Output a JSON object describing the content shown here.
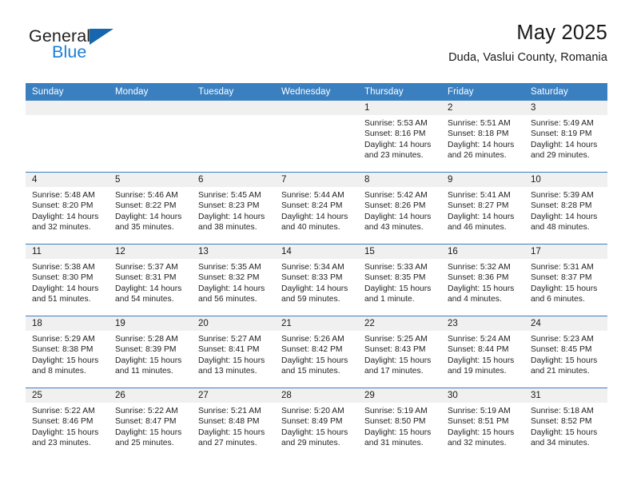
{
  "brand": {
    "name_part1": "General",
    "name_part2": "Blue",
    "triangle_color": "#1667b0",
    "blue_color": "#1c7fd4"
  },
  "header": {
    "month_title": "May 2025",
    "location": "Duda, Vaslui County, Romania"
  },
  "theme": {
    "header_blue": "#3a80c1",
    "daynum_band": "#f0f0f0",
    "cell_bg": "#ffffff",
    "text": "#1a1a1a"
  },
  "calendar": {
    "weekday_headers": [
      "Sunday",
      "Monday",
      "Tuesday",
      "Wednesday",
      "Thursday",
      "Friday",
      "Saturday"
    ],
    "weeks": [
      [
        {
          "day": "",
          "sunrise": "",
          "sunset": "",
          "daylight_line1": "",
          "daylight_line2": ""
        },
        {
          "day": "",
          "sunrise": "",
          "sunset": "",
          "daylight_line1": "",
          "daylight_line2": ""
        },
        {
          "day": "",
          "sunrise": "",
          "sunset": "",
          "daylight_line1": "",
          "daylight_line2": ""
        },
        {
          "day": "",
          "sunrise": "",
          "sunset": "",
          "daylight_line1": "",
          "daylight_line2": ""
        },
        {
          "day": "1",
          "sunrise": "Sunrise: 5:53 AM",
          "sunset": "Sunset: 8:16 PM",
          "daylight_line1": "Daylight: 14 hours",
          "daylight_line2": "and 23 minutes."
        },
        {
          "day": "2",
          "sunrise": "Sunrise: 5:51 AM",
          "sunset": "Sunset: 8:18 PM",
          "daylight_line1": "Daylight: 14 hours",
          "daylight_line2": "and 26 minutes."
        },
        {
          "day": "3",
          "sunrise": "Sunrise: 5:49 AM",
          "sunset": "Sunset: 8:19 PM",
          "daylight_line1": "Daylight: 14 hours",
          "daylight_line2": "and 29 minutes."
        }
      ],
      [
        {
          "day": "4",
          "sunrise": "Sunrise: 5:48 AM",
          "sunset": "Sunset: 8:20 PM",
          "daylight_line1": "Daylight: 14 hours",
          "daylight_line2": "and 32 minutes."
        },
        {
          "day": "5",
          "sunrise": "Sunrise: 5:46 AM",
          "sunset": "Sunset: 8:22 PM",
          "daylight_line1": "Daylight: 14 hours",
          "daylight_line2": "and 35 minutes."
        },
        {
          "day": "6",
          "sunrise": "Sunrise: 5:45 AM",
          "sunset": "Sunset: 8:23 PM",
          "daylight_line1": "Daylight: 14 hours",
          "daylight_line2": "and 38 minutes."
        },
        {
          "day": "7",
          "sunrise": "Sunrise: 5:44 AM",
          "sunset": "Sunset: 8:24 PM",
          "daylight_line1": "Daylight: 14 hours",
          "daylight_line2": "and 40 minutes."
        },
        {
          "day": "8",
          "sunrise": "Sunrise: 5:42 AM",
          "sunset": "Sunset: 8:26 PM",
          "daylight_line1": "Daylight: 14 hours",
          "daylight_line2": "and 43 minutes."
        },
        {
          "day": "9",
          "sunrise": "Sunrise: 5:41 AM",
          "sunset": "Sunset: 8:27 PM",
          "daylight_line1": "Daylight: 14 hours",
          "daylight_line2": "and 46 minutes."
        },
        {
          "day": "10",
          "sunrise": "Sunrise: 5:39 AM",
          "sunset": "Sunset: 8:28 PM",
          "daylight_line1": "Daylight: 14 hours",
          "daylight_line2": "and 48 minutes."
        }
      ],
      [
        {
          "day": "11",
          "sunrise": "Sunrise: 5:38 AM",
          "sunset": "Sunset: 8:30 PM",
          "daylight_line1": "Daylight: 14 hours",
          "daylight_line2": "and 51 minutes."
        },
        {
          "day": "12",
          "sunrise": "Sunrise: 5:37 AM",
          "sunset": "Sunset: 8:31 PM",
          "daylight_line1": "Daylight: 14 hours",
          "daylight_line2": "and 54 minutes."
        },
        {
          "day": "13",
          "sunrise": "Sunrise: 5:35 AM",
          "sunset": "Sunset: 8:32 PM",
          "daylight_line1": "Daylight: 14 hours",
          "daylight_line2": "and 56 minutes."
        },
        {
          "day": "14",
          "sunrise": "Sunrise: 5:34 AM",
          "sunset": "Sunset: 8:33 PM",
          "daylight_line1": "Daylight: 14 hours",
          "daylight_line2": "and 59 minutes."
        },
        {
          "day": "15",
          "sunrise": "Sunrise: 5:33 AM",
          "sunset": "Sunset: 8:35 PM",
          "daylight_line1": "Daylight: 15 hours",
          "daylight_line2": "and 1 minute."
        },
        {
          "day": "16",
          "sunrise": "Sunrise: 5:32 AM",
          "sunset": "Sunset: 8:36 PM",
          "daylight_line1": "Daylight: 15 hours",
          "daylight_line2": "and 4 minutes."
        },
        {
          "day": "17",
          "sunrise": "Sunrise: 5:31 AM",
          "sunset": "Sunset: 8:37 PM",
          "daylight_line1": "Daylight: 15 hours",
          "daylight_line2": "and 6 minutes."
        }
      ],
      [
        {
          "day": "18",
          "sunrise": "Sunrise: 5:29 AM",
          "sunset": "Sunset: 8:38 PM",
          "daylight_line1": "Daylight: 15 hours",
          "daylight_line2": "and 8 minutes."
        },
        {
          "day": "19",
          "sunrise": "Sunrise: 5:28 AM",
          "sunset": "Sunset: 8:39 PM",
          "daylight_line1": "Daylight: 15 hours",
          "daylight_line2": "and 11 minutes."
        },
        {
          "day": "20",
          "sunrise": "Sunrise: 5:27 AM",
          "sunset": "Sunset: 8:41 PM",
          "daylight_line1": "Daylight: 15 hours",
          "daylight_line2": "and 13 minutes."
        },
        {
          "day": "21",
          "sunrise": "Sunrise: 5:26 AM",
          "sunset": "Sunset: 8:42 PM",
          "daylight_line1": "Daylight: 15 hours",
          "daylight_line2": "and 15 minutes."
        },
        {
          "day": "22",
          "sunrise": "Sunrise: 5:25 AM",
          "sunset": "Sunset: 8:43 PM",
          "daylight_line1": "Daylight: 15 hours",
          "daylight_line2": "and 17 minutes."
        },
        {
          "day": "23",
          "sunrise": "Sunrise: 5:24 AM",
          "sunset": "Sunset: 8:44 PM",
          "daylight_line1": "Daylight: 15 hours",
          "daylight_line2": "and 19 minutes."
        },
        {
          "day": "24",
          "sunrise": "Sunrise: 5:23 AM",
          "sunset": "Sunset: 8:45 PM",
          "daylight_line1": "Daylight: 15 hours",
          "daylight_line2": "and 21 minutes."
        }
      ],
      [
        {
          "day": "25",
          "sunrise": "Sunrise: 5:22 AM",
          "sunset": "Sunset: 8:46 PM",
          "daylight_line1": "Daylight: 15 hours",
          "daylight_line2": "and 23 minutes."
        },
        {
          "day": "26",
          "sunrise": "Sunrise: 5:22 AM",
          "sunset": "Sunset: 8:47 PM",
          "daylight_line1": "Daylight: 15 hours",
          "daylight_line2": "and 25 minutes."
        },
        {
          "day": "27",
          "sunrise": "Sunrise: 5:21 AM",
          "sunset": "Sunset: 8:48 PM",
          "daylight_line1": "Daylight: 15 hours",
          "daylight_line2": "and 27 minutes."
        },
        {
          "day": "28",
          "sunrise": "Sunrise: 5:20 AM",
          "sunset": "Sunset: 8:49 PM",
          "daylight_line1": "Daylight: 15 hours",
          "daylight_line2": "and 29 minutes."
        },
        {
          "day": "29",
          "sunrise": "Sunrise: 5:19 AM",
          "sunset": "Sunset: 8:50 PM",
          "daylight_line1": "Daylight: 15 hours",
          "daylight_line2": "and 31 minutes."
        },
        {
          "day": "30",
          "sunrise": "Sunrise: 5:19 AM",
          "sunset": "Sunset: 8:51 PM",
          "daylight_line1": "Daylight: 15 hours",
          "daylight_line2": "and 32 minutes."
        },
        {
          "day": "31",
          "sunrise": "Sunrise: 5:18 AM",
          "sunset": "Sunset: 8:52 PM",
          "daylight_line1": "Daylight: 15 hours",
          "daylight_line2": "and 34 minutes."
        }
      ]
    ]
  }
}
